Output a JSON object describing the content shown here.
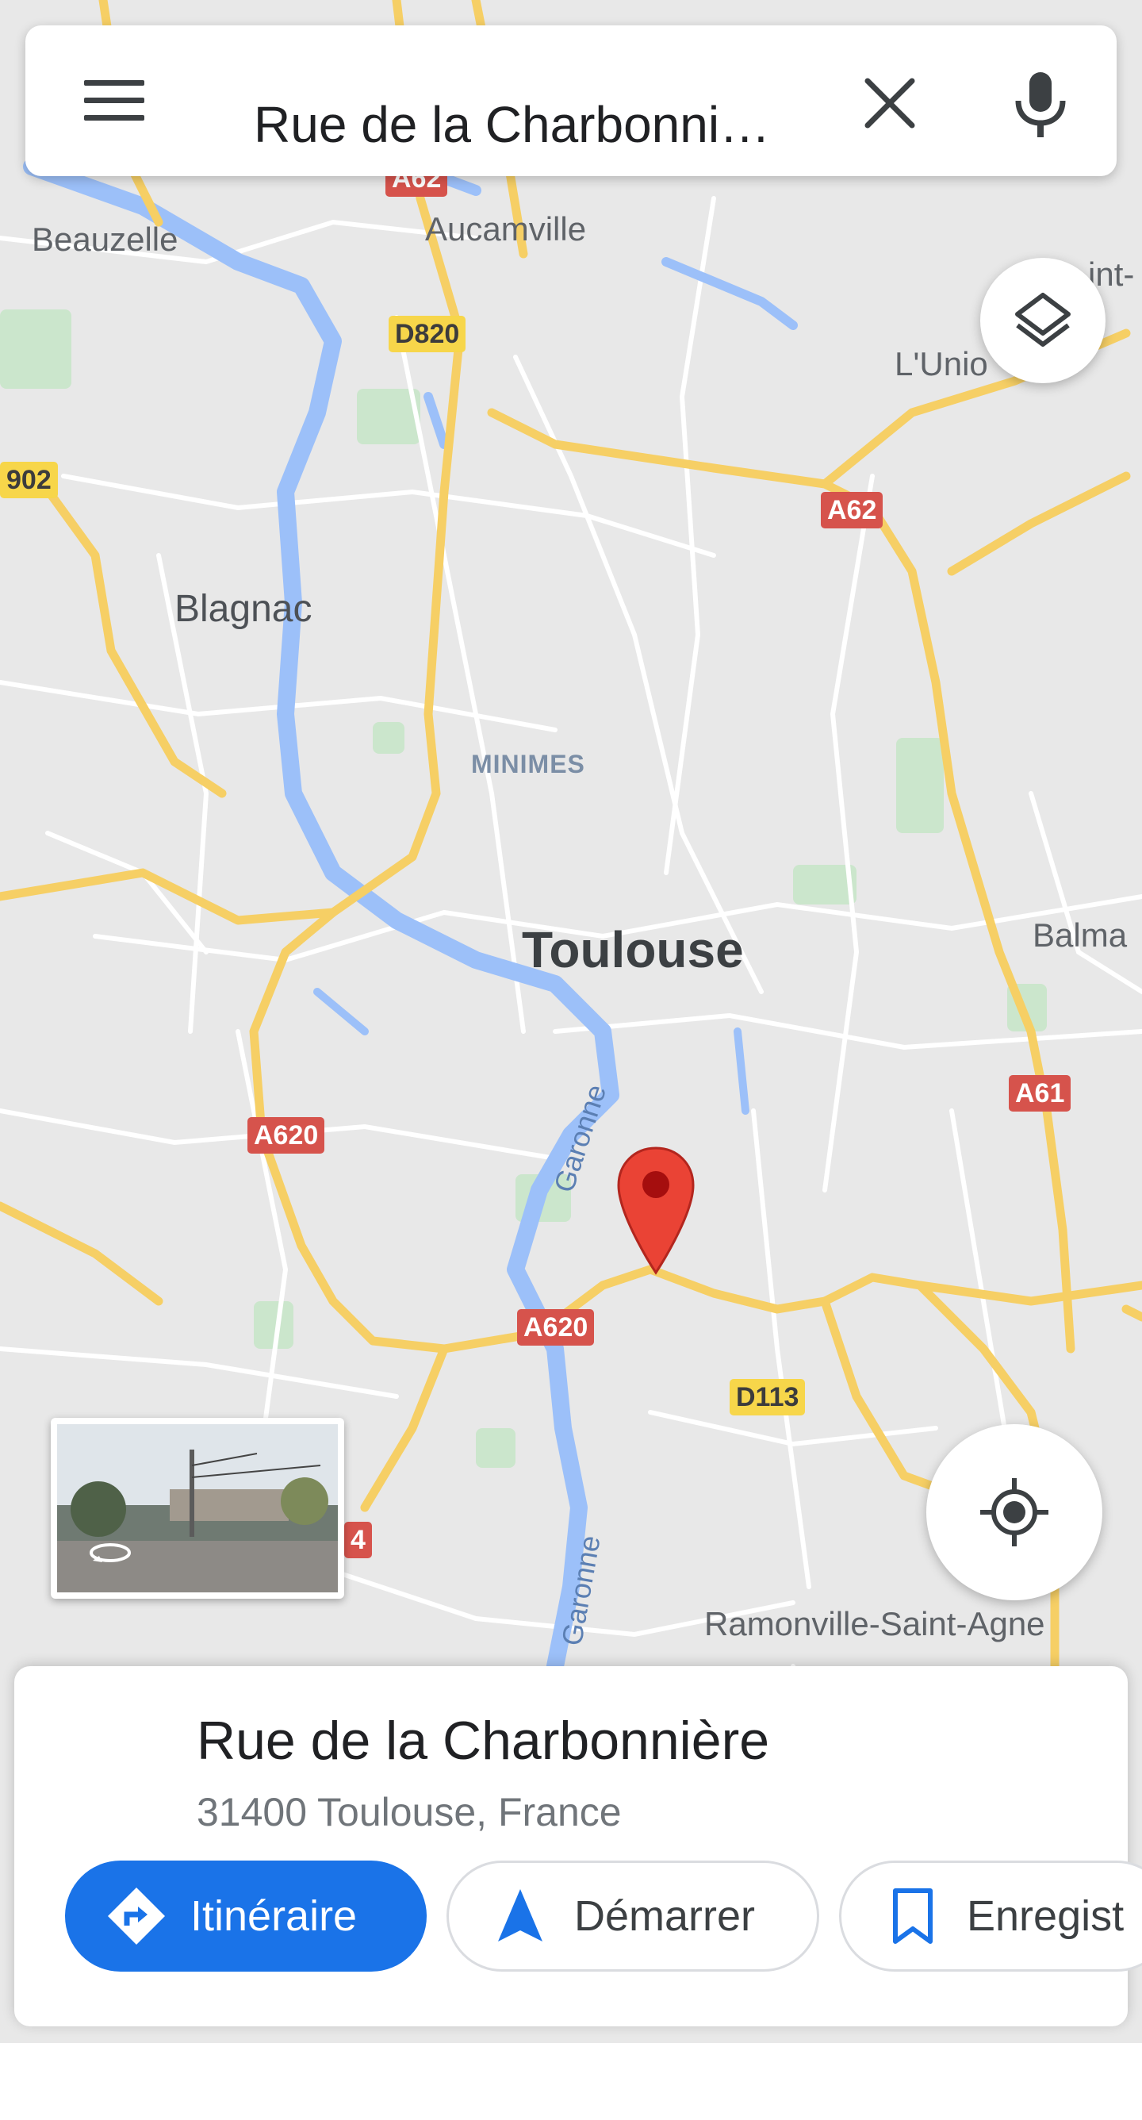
{
  "search": {
    "query": "Rue de la Charbonni…"
  },
  "map": {
    "colors": {
      "land": "#e8e8e8",
      "road": "#ffffff",
      "highway": "#f6cf65",
      "water": "#9cc0f9",
      "park": "#c8e6c9",
      "marker": "#ea4335"
    },
    "places": {
      "beauzelle": "Beauzelle",
      "aucamville": "Aucamville",
      "saint": "int-",
      "lunion": "L'Unio",
      "blagnac": "Blagnac",
      "minimes": "MINIMES",
      "toulouse": "Toulouse",
      "balma": "Balma",
      "ramonville": "Ramonville-Saint-Agne"
    },
    "rivers": {
      "garonne_upper": "Garonne",
      "garonne_lower": "Garonne"
    },
    "road_labels": {
      "a62_top": "A62",
      "d820": "D820",
      "d902": "902",
      "a62": "A62",
      "a620_left": "A620",
      "a61": "A61",
      "a620_bottom": "A620",
      "d113": "D113",
      "a64_partial": "4"
    },
    "icons": {
      "layers": "layers-icon",
      "my_location": "my-location-icon",
      "marker": "location-pin-icon",
      "street_view": "street-view-icon"
    }
  },
  "place_card": {
    "title": "Rue de la Charbonnière",
    "address": "31400 Toulouse, France",
    "buttons": {
      "directions": "Itinéraire",
      "start": "Démarrer",
      "save": "Enregist"
    }
  }
}
